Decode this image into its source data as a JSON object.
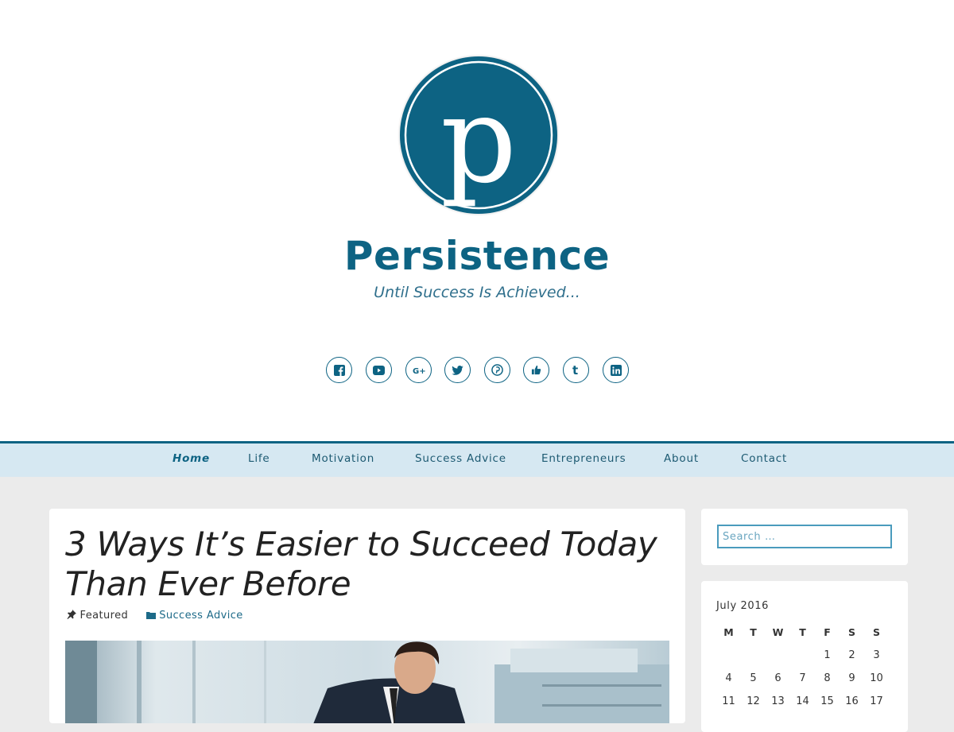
{
  "site": {
    "logo_letter": "p",
    "title": "Persistence",
    "tagline": "Until Success Is Achieved..."
  },
  "colors": {
    "brand": "#0d6383",
    "nav_bg": "#d6e8f2",
    "page_bg": "#ebebeb"
  },
  "social": [
    {
      "icon": "facebook-icon"
    },
    {
      "icon": "youtube-icon"
    },
    {
      "icon": "google-plus-icon"
    },
    {
      "icon": "twitter-icon"
    },
    {
      "icon": "pinterest-icon"
    },
    {
      "icon": "thumbs-up-icon"
    },
    {
      "icon": "tumblr-icon"
    },
    {
      "icon": "linkedin-icon"
    }
  ],
  "nav": {
    "items": [
      {
        "label": "Home",
        "active": true
      },
      {
        "label": "Life"
      },
      {
        "label": "Motivation"
      },
      {
        "label": "Success Advice"
      },
      {
        "label": "Entrepreneurs"
      },
      {
        "label": "About"
      },
      {
        "label": "Contact"
      }
    ]
  },
  "post": {
    "title_line1": "3 Ways It’s Easier to Succeed Today",
    "title_line2": "Than Ever Before",
    "meta_featured": "Featured",
    "meta_category": "Success Advice"
  },
  "search": {
    "placeholder": "Search …"
  },
  "calendar": {
    "caption": "July 2016",
    "weekdays": [
      "M",
      "T",
      "W",
      "T",
      "F",
      "S",
      "S"
    ],
    "weeks": [
      [
        "",
        "",
        "",
        "",
        "1",
        "2",
        "3"
      ],
      [
        "4",
        "5",
        "6",
        "7",
        "8",
        "9",
        "10"
      ],
      [
        "11",
        "12",
        "13",
        "14",
        "15",
        "16",
        "17"
      ]
    ]
  }
}
